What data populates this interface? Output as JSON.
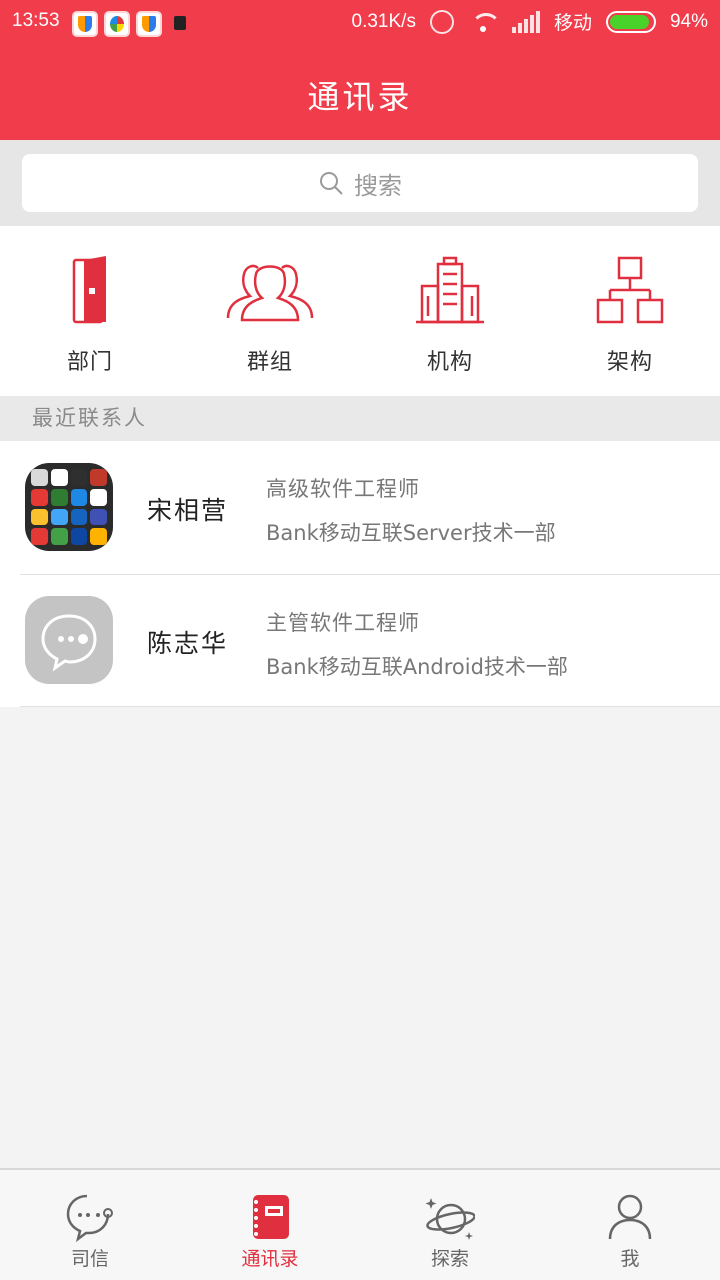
{
  "status_bar": {
    "time": "13:53",
    "speed": "0.31K/s",
    "carrier": "移动",
    "battery": "94%"
  },
  "header": {
    "title": "通讯录"
  },
  "search": {
    "placeholder": "搜索"
  },
  "categories": [
    {
      "label": "部门",
      "icon": "door-icon"
    },
    {
      "label": "群组",
      "icon": "group-icon"
    },
    {
      "label": "机构",
      "icon": "building-icon"
    },
    {
      "label": "架构",
      "icon": "org-chart-icon"
    }
  ],
  "section_title": "最近联系人",
  "contacts": [
    {
      "name": "宋相营",
      "role": "高级软件工程师",
      "dept": "Bank移动互联Server技术一部"
    },
    {
      "name": "陈志华",
      "role": "主管软件工程师",
      "dept": "Bank移动互联Android技术一部"
    }
  ],
  "tabs": [
    {
      "label": "司信",
      "icon": "chat-bubble-icon"
    },
    {
      "label": "通讯录",
      "icon": "address-book-icon",
      "active": true
    },
    {
      "label": "探索",
      "icon": "planet-icon"
    },
    {
      "label": "我",
      "icon": "person-icon"
    }
  ],
  "colors": {
    "accent": "#f13c4b",
    "active_tab": "#e0303f"
  }
}
